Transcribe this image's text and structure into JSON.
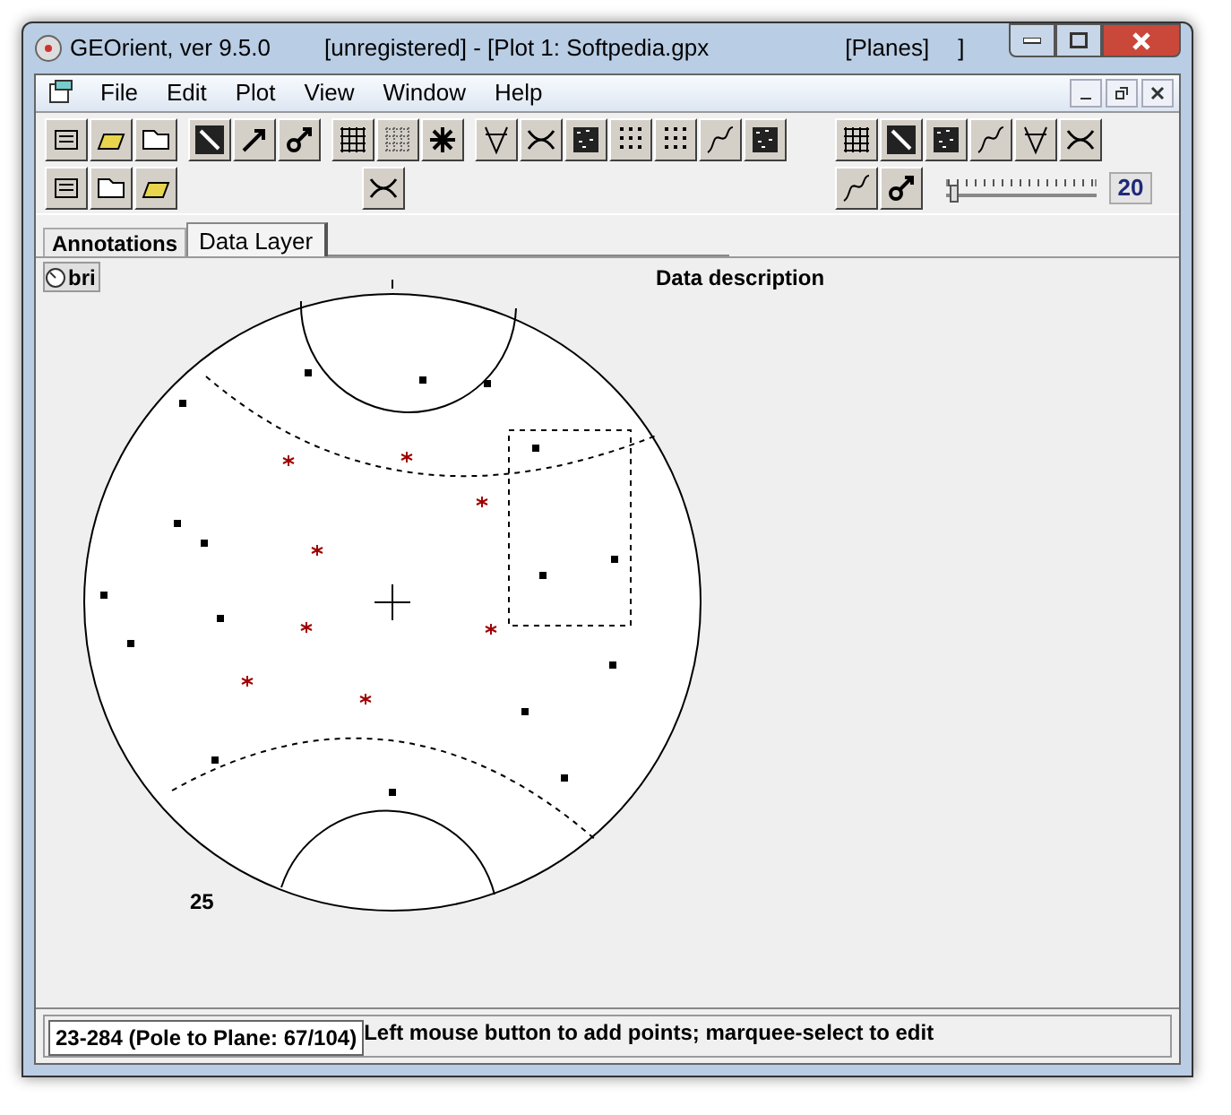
{
  "window": {
    "title_parts": [
      "GEOrient, ver 9.5.0",
      "[unregistered] - [Plot 1: Softpedia.gpx",
      "[Planes]",
      "]"
    ]
  },
  "menu": [
    "File",
    "Edit",
    "Plot",
    "View",
    "Window",
    "Help"
  ],
  "toolbar": {
    "size_value": "20",
    "size_slider": {
      "level": 0.03
    }
  },
  "tabs": [
    {
      "label": "Annotations",
      "selected": false
    },
    {
      "label": "Data Layer",
      "selected": true
    }
  ],
  "canvas": {
    "layer_button": "bri",
    "description": "Data description",
    "count": "25"
  },
  "status_bar": {
    "cursor": "23-284  (Pole to Plane: 67/104)",
    "hint": "Left mouse button to add points; marquee-select to edit"
  }
}
